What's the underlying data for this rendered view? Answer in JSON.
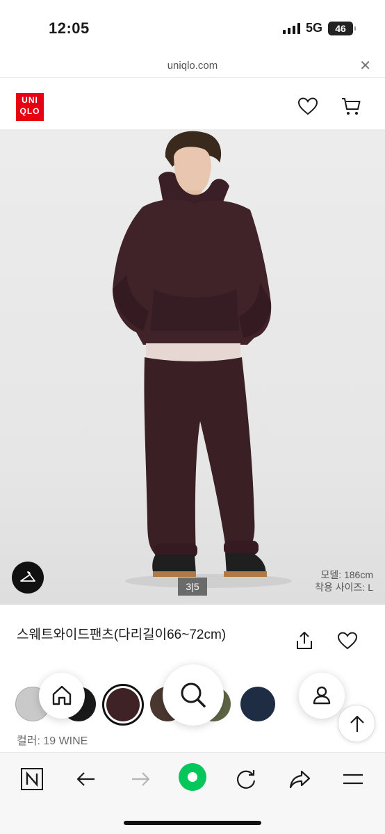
{
  "status_bar": {
    "time": "12:05",
    "network": "5G",
    "battery": "46"
  },
  "browser": {
    "url": "uniqlo.com",
    "close_icon": "close-icon"
  },
  "header": {
    "logo_line1": "UNI",
    "logo_line2": "QLO",
    "brand_color": "#e60012",
    "icons": [
      "heart-icon",
      "cart-icon"
    ]
  },
  "hero": {
    "page_indicator": "3|5",
    "model_height": "모델: 186cm",
    "wearing_size": "착용 사이즈: L"
  },
  "product": {
    "title": "스웨트와이드팬츠(다리길이66~72cm)",
    "color_label": "컬러: 19 WINE",
    "swatches": [
      {
        "name": "light-gray",
        "color": "#c9c9c9"
      },
      {
        "name": "black",
        "color": "#1a1a1a"
      },
      {
        "name": "wine",
        "color": "#3e2226",
        "selected": true
      },
      {
        "name": "brown",
        "color": "#4a3730"
      },
      {
        "name": "olive",
        "color": "#5f6646"
      },
      {
        "name": "navy",
        "color": "#1e2c44"
      }
    ]
  },
  "bottom_bar": {
    "icons": [
      "naver-n-icon",
      "back-arrow-icon",
      "forward-arrow-icon",
      "green-circle-icon",
      "refresh-icon",
      "share-icon",
      "menu-icon"
    ],
    "accent": "#03c75a"
  }
}
